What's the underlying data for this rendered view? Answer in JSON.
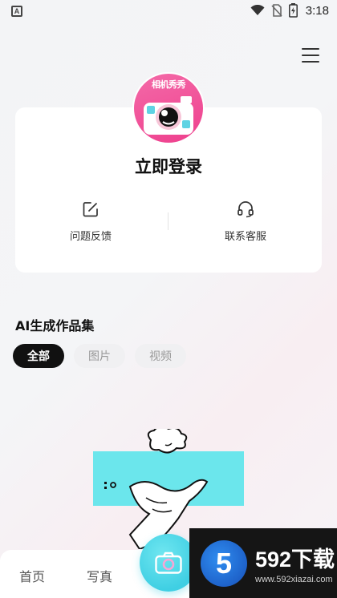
{
  "status_bar": {
    "time": "3:18",
    "app_icon_letter": "A"
  },
  "header": {
    "menu_icon": "menu-icon"
  },
  "profile": {
    "avatar_text": "相机秀秀",
    "login_label": "立即登录",
    "actions": [
      {
        "label": "问题反馈",
        "icon": "edit-icon"
      },
      {
        "label": "联系客服",
        "icon": "headset-icon"
      }
    ]
  },
  "gallery": {
    "title": "AI生成作品集",
    "tabs": [
      {
        "label": "全部",
        "active": true
      },
      {
        "label": "图片",
        "active": false
      },
      {
        "label": "视频",
        "active": false
      }
    ]
  },
  "bottom_nav": {
    "items": [
      {
        "label": "首页"
      },
      {
        "label": "写真"
      }
    ],
    "center_icon": "camera-icon"
  },
  "watermark": {
    "brand": "592下载",
    "url": "www.592xiazai.com",
    "logo": "5"
  },
  "colors": {
    "accent_cyan": "#3fcfe3",
    "avatar_pink": "#ee3f8d",
    "active_tab": "#111111"
  }
}
